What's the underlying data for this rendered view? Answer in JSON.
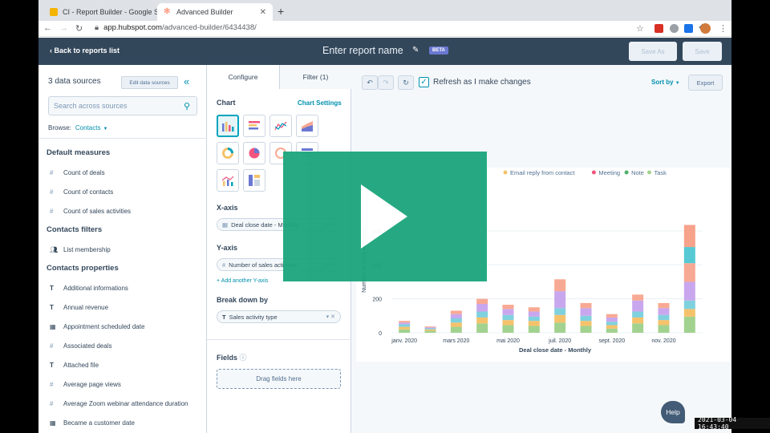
{
  "browser": {
    "tabs": [
      {
        "label": "CI - Report Builder - Google S"
      },
      {
        "label": "Advanced Builder"
      }
    ],
    "new_tab": "+",
    "url_domain": "app.hubspot.com",
    "url_path": "/advanced-builder/6434438/"
  },
  "header": {
    "back_label": "Back to reports list",
    "report_name": "Enter report name",
    "beta": "BETA",
    "save_as": "Save As",
    "save": "Save"
  },
  "left": {
    "data_sources": "3 data sources",
    "edit_sources": "Edit data sources",
    "search_placeholder": "Search across sources",
    "browse_label": "Browse:",
    "browse_value": "Contacts",
    "sections": [
      {
        "title": "Default measures",
        "items": [
          {
            "icon": "#",
            "label": "Count of deals"
          },
          {
            "icon": "#",
            "label": "Count of contacts"
          },
          {
            "icon": "#",
            "label": "Count of sales activities"
          }
        ]
      },
      {
        "title": "Contacts filters",
        "items": [
          {
            "icon": "people-icon",
            "label": "List membership"
          }
        ]
      },
      {
        "title": "Contacts properties",
        "items": [
          {
            "icon": "T",
            "label": "Additional informations"
          },
          {
            "icon": "T",
            "label": "Annual revenue"
          },
          {
            "icon": "calendar-icon",
            "label": "Appointment scheduled date"
          },
          {
            "icon": "#",
            "label": "Associated deals"
          },
          {
            "icon": "T",
            "label": "Attached file"
          },
          {
            "icon": "#",
            "label": "Average page views"
          },
          {
            "icon": "#",
            "label": "Average Zoom webinar attendance duration"
          },
          {
            "icon": "calendar-icon",
            "label": "Became a customer date"
          }
        ]
      }
    ]
  },
  "middle": {
    "tab_configure": "Configure",
    "tab_filter": "Filter (1)",
    "chart_label": "Chart",
    "chart_settings": "Chart Settings",
    "xaxis_label": "X-axis",
    "xaxis_value": "Deal close date - Monthly",
    "yaxis_label": "Y-axis",
    "yaxis_value": "Number of sales activities",
    "add_y": "Add another Y-axis",
    "breakdown_label": "Break down by",
    "breakdown_value": "Sales activity type",
    "fields_label": "Fields",
    "drag_fields": "Drag fields here"
  },
  "right": {
    "refresh_label": "Refresh as I make changes",
    "sort_by": "Sort by",
    "export": "Export",
    "legend_visible": [
      {
        "name": "Email reply from contact",
        "color": "#f5c26b"
      },
      {
        "name": "Meeting",
        "color": "#f2547d"
      },
      {
        "name": "Note",
        "color": "#4fb06d"
      },
      {
        "name": "Task",
        "color": "#a2d28f"
      }
    ]
  },
  "chart_data": {
    "type": "bar",
    "stacked": true,
    "xlabel": "Deal close date - Monthly",
    "ylabel": "Number of sales activities",
    "yticks": [
      0,
      200,
      400,
      600
    ],
    "ylim": [
      0,
      850
    ],
    "x_tick_labels": [
      "janv. 2020",
      "mars 2020",
      "mai 2020",
      "juil. 2020",
      "sept. 2020",
      "nov. 2020"
    ],
    "categories": [
      "janv. 2020",
      "févr. 2020",
      "mars 2020",
      "avr. 2020",
      "mai 2020",
      "juin 2020",
      "juil. 2020",
      "août 2020",
      "sept. 2020",
      "oct. 2020",
      "nov. 2020",
      "déc. 2020"
    ],
    "series": [
      {
        "color": "#a2d28f",
        "values": [
          20,
          12,
          35,
          55,
          45,
          40,
          60,
          40,
          25,
          55,
          45,
          95
        ]
      },
      {
        "color": "#f5c26b",
        "values": [
          15,
          8,
          25,
          35,
          30,
          30,
          45,
          30,
          20,
          35,
          30,
          45
        ]
      },
      {
        "color": "#7fd1de",
        "values": [
          15,
          6,
          25,
          35,
          30,
          25,
          40,
          30,
          20,
          35,
          30,
          50
        ]
      },
      {
        "color": "#c9a7ee",
        "values": [
          10,
          6,
          25,
          45,
          35,
          30,
          100,
          45,
          25,
          65,
          40,
          110
        ]
      },
      {
        "color": "#f8a993",
        "values": [
          10,
          5,
          20,
          30,
          25,
          25,
          70,
          30,
          20,
          35,
          30,
          110
        ]
      },
      {
        "color": "#56c9d4",
        "values": [
          0,
          0,
          0,
          0,
          0,
          0,
          0,
          0,
          0,
          0,
          0,
          95
        ]
      },
      {
        "color": "#f7a28a",
        "values": [
          0,
          0,
          0,
          0,
          0,
          0,
          0,
          0,
          0,
          0,
          0,
          130
        ]
      }
    ]
  },
  "overlay": {
    "help": "Help",
    "timestamp": "2021-03-04 16:43:40"
  },
  "colors": {
    "header_bg": "#33475b",
    "accent": "#0091ae",
    "play_overlay": "#1ba57c"
  }
}
